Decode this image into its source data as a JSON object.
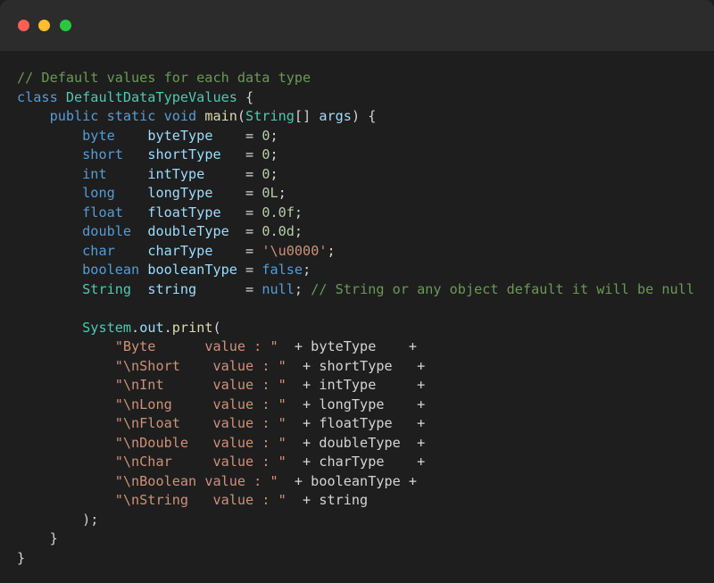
{
  "window": {
    "buttons": [
      "close",
      "minimize",
      "maximize"
    ]
  },
  "code": {
    "lines": [
      [
        {
          "t": "// Default values for each data type",
          "c": "cm"
        }
      ],
      [
        {
          "t": "class ",
          "c": "kw"
        },
        {
          "t": "DefaultDataTypeValues",
          "c": "ty"
        },
        {
          "t": " {",
          "c": "pl"
        }
      ],
      [
        {
          "t": "    ",
          "c": "pl"
        },
        {
          "t": "public static void ",
          "c": "kw"
        },
        {
          "t": "main",
          "c": "fn"
        },
        {
          "t": "(",
          "c": "pl"
        },
        {
          "t": "String",
          "c": "ty"
        },
        {
          "t": "[] ",
          "c": "pl"
        },
        {
          "t": "args",
          "c": "vr"
        },
        {
          "t": ") {",
          "c": "pl"
        }
      ],
      [
        {
          "t": "        ",
          "c": "pl"
        },
        {
          "t": "byte    ",
          "c": "kw"
        },
        {
          "t": "byteType",
          "c": "vr"
        },
        {
          "t": "    = ",
          "c": "pl"
        },
        {
          "t": "0",
          "c": "nu"
        },
        {
          "t": ";",
          "c": "pl"
        }
      ],
      [
        {
          "t": "        ",
          "c": "pl"
        },
        {
          "t": "short   ",
          "c": "kw"
        },
        {
          "t": "shortType",
          "c": "vr"
        },
        {
          "t": "   = ",
          "c": "pl"
        },
        {
          "t": "0",
          "c": "nu"
        },
        {
          "t": ";",
          "c": "pl"
        }
      ],
      [
        {
          "t": "        ",
          "c": "pl"
        },
        {
          "t": "int     ",
          "c": "kw"
        },
        {
          "t": "intType",
          "c": "vr"
        },
        {
          "t": "     = ",
          "c": "pl"
        },
        {
          "t": "0",
          "c": "nu"
        },
        {
          "t": ";",
          "c": "pl"
        }
      ],
      [
        {
          "t": "        ",
          "c": "pl"
        },
        {
          "t": "long    ",
          "c": "kw"
        },
        {
          "t": "longType",
          "c": "vr"
        },
        {
          "t": "    = ",
          "c": "pl"
        },
        {
          "t": "0L",
          "c": "nu"
        },
        {
          "t": ";",
          "c": "pl"
        }
      ],
      [
        {
          "t": "        ",
          "c": "pl"
        },
        {
          "t": "float   ",
          "c": "kw"
        },
        {
          "t": "floatType",
          "c": "vr"
        },
        {
          "t": "   = ",
          "c": "pl"
        },
        {
          "t": "0.0f",
          "c": "nu"
        },
        {
          "t": ";",
          "c": "pl"
        }
      ],
      [
        {
          "t": "        ",
          "c": "pl"
        },
        {
          "t": "double  ",
          "c": "kw"
        },
        {
          "t": "doubleType",
          "c": "vr"
        },
        {
          "t": "  = ",
          "c": "pl"
        },
        {
          "t": "0.0d",
          "c": "nu"
        },
        {
          "t": ";",
          "c": "pl"
        }
      ],
      [
        {
          "t": "        ",
          "c": "pl"
        },
        {
          "t": "char    ",
          "c": "kw"
        },
        {
          "t": "charType",
          "c": "vr"
        },
        {
          "t": "    = ",
          "c": "pl"
        },
        {
          "t": "'\\u0000'",
          "c": "st"
        },
        {
          "t": ";",
          "c": "pl"
        }
      ],
      [
        {
          "t": "        ",
          "c": "pl"
        },
        {
          "t": "boolean ",
          "c": "kw"
        },
        {
          "t": "booleanType",
          "c": "vr"
        },
        {
          "t": " = ",
          "c": "pl"
        },
        {
          "t": "false",
          "c": "kw"
        },
        {
          "t": ";",
          "c": "pl"
        }
      ],
      [
        {
          "t": "        ",
          "c": "pl"
        },
        {
          "t": "String  ",
          "c": "ty"
        },
        {
          "t": "string",
          "c": "vr"
        },
        {
          "t": "      = ",
          "c": "pl"
        },
        {
          "t": "null",
          "c": "kw"
        },
        {
          "t": "; ",
          "c": "pl"
        },
        {
          "t": "// String or any object default it will be null",
          "c": "cm"
        }
      ],
      [
        {
          "t": "",
          "c": "pl"
        }
      ],
      [
        {
          "t": "        ",
          "c": "pl"
        },
        {
          "t": "System",
          "c": "ty"
        },
        {
          "t": ".",
          "c": "pl"
        },
        {
          "t": "out",
          "c": "vr"
        },
        {
          "t": ".",
          "c": "pl"
        },
        {
          "t": "print",
          "c": "fn"
        },
        {
          "t": "(",
          "c": "pl"
        }
      ],
      [
        {
          "t": "            ",
          "c": "pl"
        },
        {
          "t": "\"Byte      value : \"",
          "c": "st"
        },
        {
          "t": "  + byteType    +",
          "c": "pl"
        }
      ],
      [
        {
          "t": "            ",
          "c": "pl"
        },
        {
          "t": "\"\\nShort    value : \"",
          "c": "st"
        },
        {
          "t": "  + shortType   +",
          "c": "pl"
        }
      ],
      [
        {
          "t": "            ",
          "c": "pl"
        },
        {
          "t": "\"\\nInt      value : \"",
          "c": "st"
        },
        {
          "t": "  + intType     +",
          "c": "pl"
        }
      ],
      [
        {
          "t": "            ",
          "c": "pl"
        },
        {
          "t": "\"\\nLong     value : \"",
          "c": "st"
        },
        {
          "t": "  + longType    +",
          "c": "pl"
        }
      ],
      [
        {
          "t": "            ",
          "c": "pl"
        },
        {
          "t": "\"\\nFloat    value : \"",
          "c": "st"
        },
        {
          "t": "  + floatType   +",
          "c": "pl"
        }
      ],
      [
        {
          "t": "            ",
          "c": "pl"
        },
        {
          "t": "\"\\nDouble   value : \"",
          "c": "st"
        },
        {
          "t": "  + doubleType  +",
          "c": "pl"
        }
      ],
      [
        {
          "t": "            ",
          "c": "pl"
        },
        {
          "t": "\"\\nChar     value : \"",
          "c": "st"
        },
        {
          "t": "  + charType    +",
          "c": "pl"
        }
      ],
      [
        {
          "t": "            ",
          "c": "pl"
        },
        {
          "t": "\"\\nBoolean value : \"",
          "c": "st"
        },
        {
          "t": "  + booleanType +",
          "c": "pl"
        }
      ],
      [
        {
          "t": "            ",
          "c": "pl"
        },
        {
          "t": "\"\\nString   value : \"",
          "c": "st"
        },
        {
          "t": "  + string",
          "c": "pl"
        }
      ],
      [
        {
          "t": "        );",
          "c": "pl"
        }
      ],
      [
        {
          "t": "    }",
          "c": "pl"
        }
      ],
      [
        {
          "t": "}",
          "c": "pl"
        }
      ]
    ]
  }
}
